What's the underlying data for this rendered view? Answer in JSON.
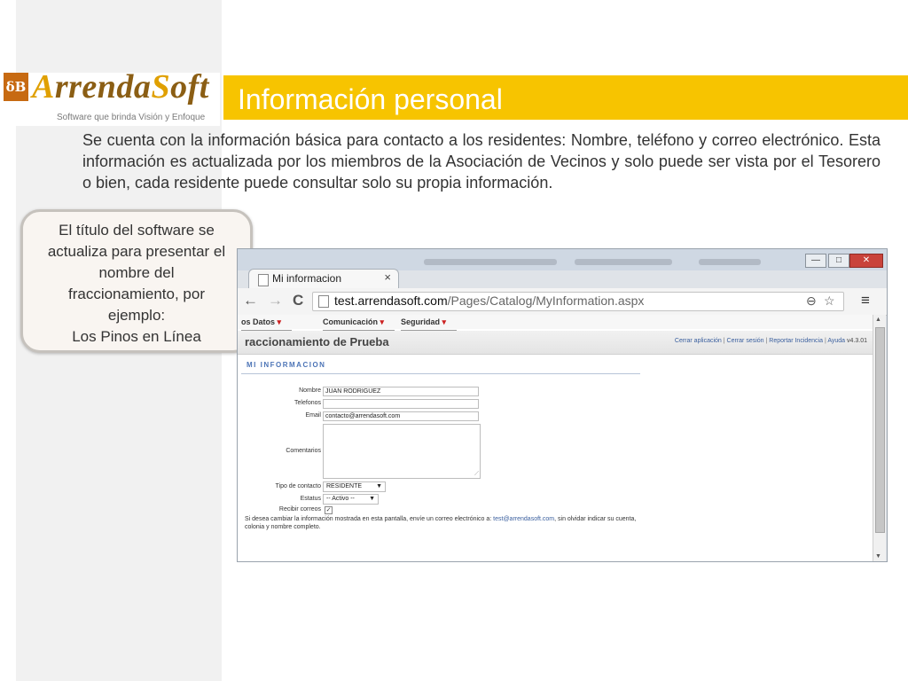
{
  "slide": {
    "logo": {
      "mark": "δB",
      "name_prefix": "A",
      "name_rest": "rrenda",
      "name_cap2": "S",
      "name_rest2": "oft",
      "tagline": "Software que brinda Visión y Enfoque"
    },
    "title": "Información personal",
    "intro": "Se cuenta con la información básica para contacto a los residentes: Nombre, teléfono y correo electrónico. Esta información es actualizada por los miembros de la Asociación de Vecinos y solo puede ser vista por el Tesorero o bien, cada residente puede consultar solo su propia información.",
    "callout_lines": [
      "El título del software se",
      "actualiza para presentar el",
      "nombre del",
      "fraccionamiento, por",
      "ejemplo:",
      "Los Pinos en Línea"
    ]
  },
  "browser": {
    "tab_label": "Mi informacion",
    "tab_close": "×",
    "window_buttons": {
      "minimize": "—",
      "maximize": "□",
      "close": "✕"
    },
    "nav": {
      "back": "←",
      "forward": "→",
      "reload": "C",
      "menu": "≡"
    },
    "url_host": "test.arrendasoft.com",
    "url_path": "/Pages/Catalog/MyInformation.aspx",
    "icons": {
      "zoom": "⊖",
      "bookmark": "☆",
      "page": "page-icon"
    }
  },
  "app": {
    "menu": [
      {
        "label": "os Datos",
        "arrow": "▾"
      },
      {
        "label": "Comunicación",
        "arrow": "▾"
      },
      {
        "label": "Seguridad",
        "arrow": "▾"
      }
    ],
    "title": "raccionamiento de Prueba",
    "links": [
      "Cerrar aplicación",
      "Cerrar sesión",
      "Reportar Incidencia",
      "Ayuda"
    ],
    "separator": "|",
    "version": "v4.3.01",
    "section_title": "MI INFORMACION",
    "form": {
      "nombre_label": "Nombre",
      "nombre_value": "JUAN RODRIGUEZ",
      "telefonos_label": "Telefonos",
      "telefonos_value": "",
      "email_label": "Email",
      "email_value": "contacto@arrendasoft.com",
      "comentarios_label": "Comentarios",
      "tipo_label": "Tipo de contacto",
      "tipo_value": "RESIDENTE",
      "estatus_label": "Estatus",
      "estatus_value": "-- Activo --",
      "recibir_label": "Recibir correos",
      "recibir_checked": "✓",
      "select_arrow": "▼"
    },
    "note_prefix": "Si desea cambiar la información mostrada en esta pantalla, envíe un correo electrónico a:",
    "note_email": "test@arrendasoft.com",
    "note_suffix": ", sin olvidar indicar su cuenta, colonia y nombre completo."
  },
  "colors": {
    "accent": "#f7c400",
    "logo_brown": "#8b5e14",
    "link": "#3a5f9e"
  }
}
